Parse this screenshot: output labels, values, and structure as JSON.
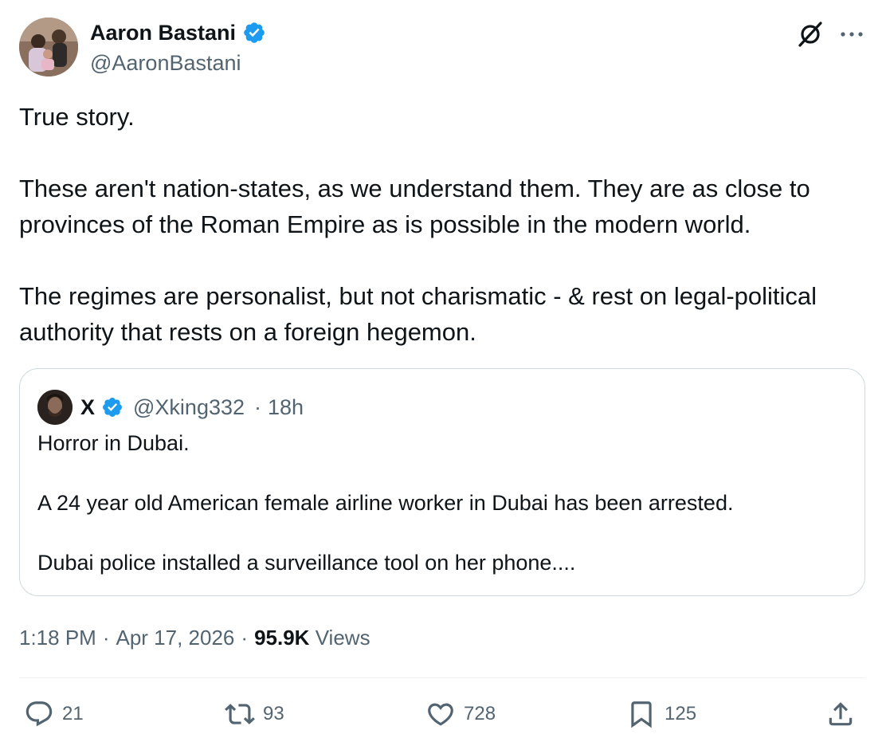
{
  "author": {
    "display_name": "Aaron Bastani",
    "handle": "@AaronBastani",
    "verified": true
  },
  "tweet": {
    "paragraphs": [
      "True story.",
      "These aren't nation-states, as we understand them. They are as close to provinces of the Roman Empire as is possible in the modern world.",
      "The regimes are personalist, but not charismatic - & rest on legal-political authority that rests on a foreign hegemon."
    ]
  },
  "quoted": {
    "display_name": "X",
    "handle": "@Xking332",
    "separator": "·",
    "time": "18h",
    "paragraphs": [
      "Horror in Dubai.",
      "A 24 year old American female airline worker in Dubai has been arrested.",
      "Dubai police installed a surveillance tool on her phone...."
    ]
  },
  "meta": {
    "time": "1:18 PM",
    "separator": "·",
    "date": "Apr 17, 2026",
    "separator2": "·",
    "views_count": "95.9K",
    "views_label": "Views"
  },
  "actions": {
    "replies": "21",
    "reposts": "93",
    "likes": "728",
    "bookmarks": "125"
  },
  "icons": {
    "verified": "verified-badge-icon",
    "grok": "grok-icon",
    "more": "more-icon",
    "reply": "reply-icon",
    "repost": "repost-icon",
    "like": "heart-icon",
    "bookmark": "bookmark-icon",
    "share": "share-icon"
  },
  "colors": {
    "text_primary": "#0f1419",
    "text_secondary": "#536471",
    "verified_blue": "#1d9bf0",
    "border": "#cfd9de"
  }
}
